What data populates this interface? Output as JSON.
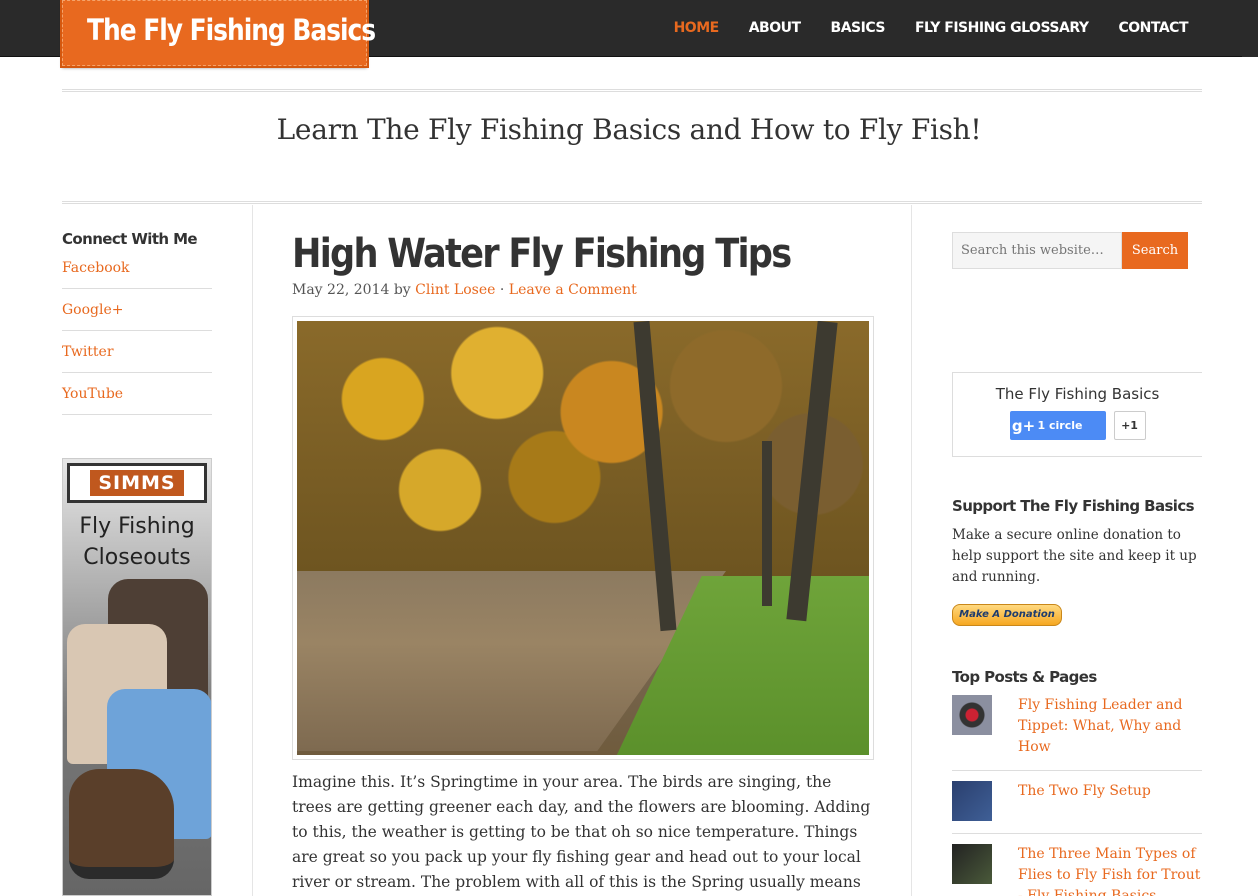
{
  "header": {
    "logo": "The Fly Fishing Basics",
    "nav": [
      "HOME",
      "ABOUT",
      "BASICS",
      "FLY FISHING GLOSSARY",
      "CONTACT"
    ]
  },
  "tagline": "Learn The Fly Fishing Basics and How to Fly Fish!",
  "left_sidebar": {
    "title": "Connect With Me",
    "links": [
      "Facebook",
      "Google+",
      "Twitter",
      "YouTube"
    ],
    "ad": {
      "brand": "SIMMS",
      "line1": "Fly Fishing",
      "line2": "Closeouts"
    }
  },
  "post": {
    "title": "High Water Fly Fishing Tips",
    "date": "May 22, 2014",
    "by": "by",
    "author": "Clint Losee",
    "separator": "·",
    "comment_link": "Leave a Comment",
    "body": "Imagine this. It’s Springtime in your area. The birds are singing, the trees are getting greener each day, and the flowers are blooming. Adding to this, the weather is getting to be that oh so nice temperature. Things are great so you pack up your fly fishing gear and head out to your local river or stream. The problem with all of this is the Spring usually means runoff and runoff equates"
  },
  "right_sidebar": {
    "search": {
      "placeholder": "Search this website…",
      "button": "Search"
    },
    "gplus": {
      "name": "The Fly Fishing Basics",
      "count": "1 circle",
      "plus_one": "+1"
    },
    "support": {
      "title": "Support The Fly Fishing Basics",
      "text": "Make a secure online donation to help support the site and keep it up and running.",
      "button": "Make A Donation"
    },
    "top_posts": {
      "title": "Top Posts & Pages",
      "items": [
        "Fly Fishing Leader and Tippet: What, Why and How",
        "The Two Fly Setup",
        "The Three Main Types of Flies to Fly Fish for Trout - Fly Fishing Basics"
      ]
    }
  },
  "colors": {
    "accent": "#e8691f",
    "header_bg": "#2a2a2a"
  }
}
